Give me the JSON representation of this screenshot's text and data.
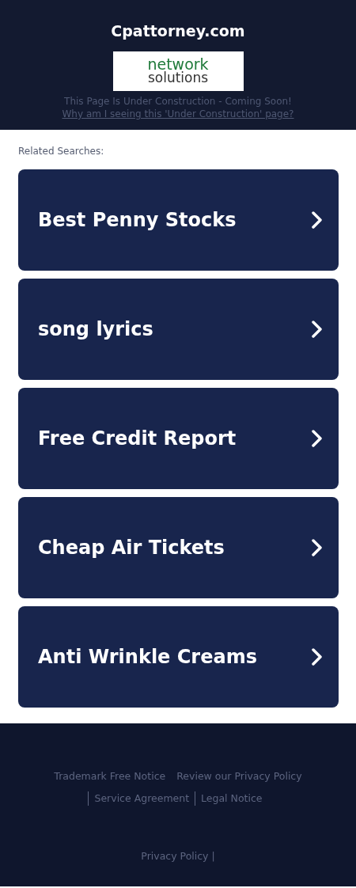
{
  "header": {
    "title": "Cpattorney.com",
    "logo": {
      "line_1": "network",
      "line_2": "solutions"
    },
    "notice": "This Page Is Under Construction - Coming Soon!",
    "notice_link": "Why am I seeing this 'Under Construction' page?"
  },
  "related": {
    "label": "Related Searches:",
    "items": [
      {
        "label": "Best Penny Stocks"
      },
      {
        "label": "song lyrics"
      },
      {
        "label": "Free Credit Report"
      },
      {
        "label": "Cheap Air Tickets"
      },
      {
        "label": "Anti Wrinkle Creams"
      }
    ]
  },
  "footer": {
    "links": [
      "Trademark Free Notice",
      "Review our Privacy Policy",
      "Service Agreement",
      "Legal Notice"
    ],
    "bottom_link": "Privacy Policy |"
  }
}
